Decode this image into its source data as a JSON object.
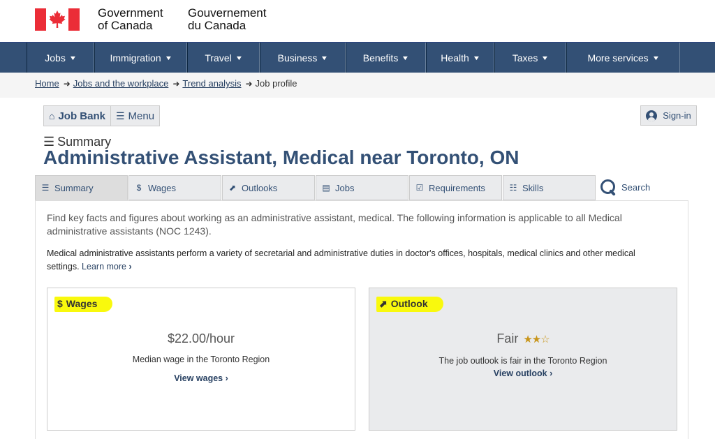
{
  "header": {
    "en_line1": "Government",
    "en_line2": "of Canada",
    "fr_line1": "Gouvernement",
    "fr_line2": "du Canada",
    "flag_color": "#eb2d37"
  },
  "menu": {
    "items": [
      "Jobs",
      "Immigration",
      "Travel",
      "Business",
      "Benefits",
      "Health",
      "Taxes",
      "More services"
    ]
  },
  "breadcrumb": {
    "links": [
      "Home",
      "Jobs and the workplace",
      "Trend analysis"
    ],
    "current": "Job profile"
  },
  "toolbar": {
    "jobbank_label": "Job Bank",
    "menu_label": "Menu",
    "signin_label": "Sign-in"
  },
  "page": {
    "section_label": "Summary",
    "title": "Administrative Assistant, Medical near Toronto, ON"
  },
  "tabs": {
    "items": [
      "Summary",
      "Wages",
      "Outlooks",
      "Jobs",
      "Requirements",
      "Skills"
    ],
    "search_label": "Search"
  },
  "content": {
    "intro": "Find key facts and figures about working as an administrative assistant, medical. The following information is applicable to all Medical administrative assistants (NOC 1243).",
    "description": "Medical administrative assistants perform a variety of secretarial and administrative duties in doctor's offices, hospitals, medical clinics and other medical settings.",
    "learn_more": "Learn more"
  },
  "wages_card": {
    "heading": "Wages",
    "value": "$22.00/hour",
    "subtitle": "Median wage in the Toronto Region",
    "link": "View wages"
  },
  "outlook_card": {
    "heading": "Outlook",
    "value": "Fair",
    "stars": "★★☆",
    "rating": 2,
    "rating_max": 3,
    "subtitle": "The job outlook is fair in the Toronto Region",
    "link": "View outlook"
  },
  "colors": {
    "nav": "#335075",
    "link": "#284162",
    "highlight": "#f9f90d"
  }
}
